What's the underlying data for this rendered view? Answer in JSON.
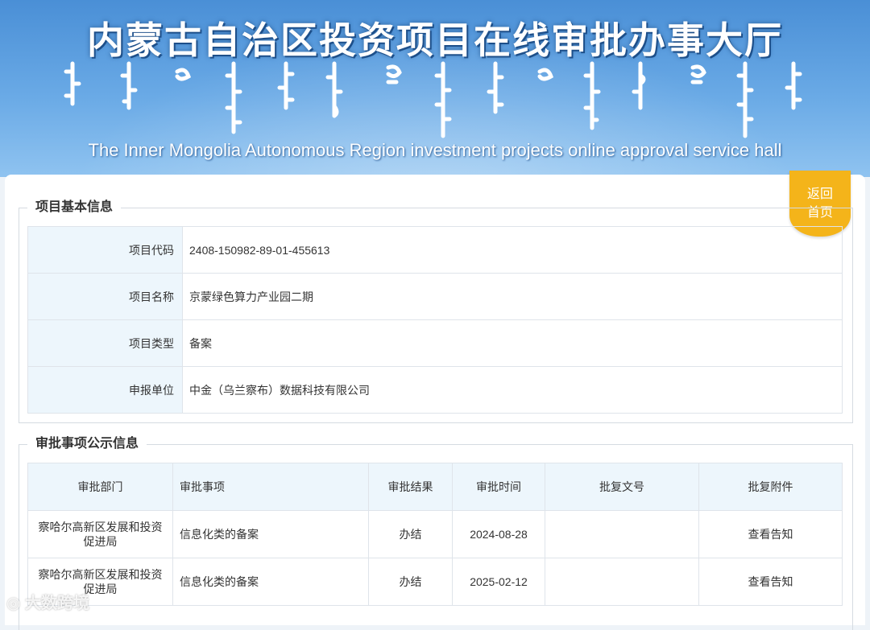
{
  "banner": {
    "title": "内蒙古自治区投资项目在线审批办事大厅",
    "subtitle": "The Inner Mongolia Autonomous Region investment projects online approval service hall"
  },
  "home_button": {
    "line1": "返回",
    "line2": "首页"
  },
  "basic_info": {
    "title": "项目基本信息",
    "rows": [
      {
        "label": "项目代码",
        "value": "2408-150982-89-01-455613"
      },
      {
        "label": "项目名称",
        "value": "京蒙绿色算力产业园二期"
      },
      {
        "label": "项目类型",
        "value": "备案"
      },
      {
        "label": "申报单位",
        "value": "中金（乌兰察布）数据科技有限公司"
      }
    ]
  },
  "approval": {
    "title": "审批事项公示信息",
    "headers": [
      "审批部门",
      "审批事项",
      "审批结果",
      "审批时间",
      "批复文号",
      "批复附件"
    ],
    "rows": [
      {
        "dept": "察哈尔高新区发展和投资促进局",
        "item": "信息化类的备案",
        "result": "办结",
        "date": "2024-08-28",
        "doc_no": "",
        "attachment": "查看告知"
      },
      {
        "dept": "察哈尔高新区发展和投资促进局",
        "item": "信息化类的备案",
        "result": "办结",
        "date": "2025-02-12",
        "doc_no": "",
        "attachment": "查看告知"
      }
    ]
  },
  "watermark": "大数跨境"
}
